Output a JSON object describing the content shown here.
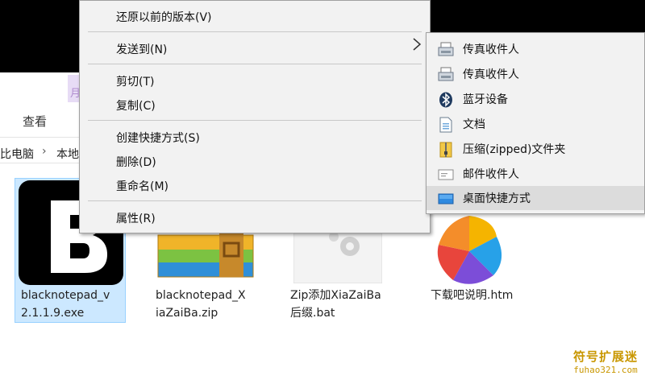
{
  "ribbon": {
    "tab_partial": "月",
    "view_label": "查看"
  },
  "address": {
    "pc": "比电脑",
    "sep": "›",
    "local": "本地"
  },
  "files": [
    {
      "name_line1": "blacknotepad_v",
      "name_line2": "2.1.1.9.exe",
      "icon": "b-letter-app-icon",
      "selected": true
    },
    {
      "name_line1": "blacknotepad_X",
      "name_line2": "iaZaiBa.zip",
      "icon": "archive-icon"
    },
    {
      "name_line1": "Zip添加XiaZaiBa",
      "name_line2": "后缀.bat",
      "icon": "batch-gear-icon"
    },
    {
      "name_line1": "下载吧说明.htm",
      "name_line2": "",
      "icon": "pinwheel-browser-icon"
    }
  ],
  "context_menu": {
    "items": [
      "还原以前的版本(V)",
      "发送到(N)",
      "剪切(T)",
      "复制(C)",
      "创建快捷方式(S)",
      "删除(D)",
      "重命名(M)",
      "属性(R)"
    ],
    "submenu_arrow_icon": "chevron-right-icon"
  },
  "send_to_menu": {
    "items": [
      {
        "label": "传真收件人",
        "icon": "fax-icon"
      },
      {
        "label": "传真收件人",
        "icon": "fax-icon"
      },
      {
        "label": "蓝牙设备",
        "icon": "bluetooth-icon"
      },
      {
        "label": "文档",
        "icon": "document-icon"
      },
      {
        "label": "压缩(zipped)文件夹",
        "icon": "zip-folder-icon"
      },
      {
        "label": "邮件收件人",
        "icon": "mail-icon"
      },
      {
        "label": "桌面快捷方式",
        "icon": "desktop-icon",
        "highlighted": true
      }
    ]
  },
  "watermark": {
    "title": "符号扩展迷",
    "url": "fuhao321.com"
  },
  "colors": {
    "selection": "#cce8ff",
    "menu_bg": "#f2f2f2",
    "hover": "#dcdcdc",
    "watermark": "#c99700"
  }
}
